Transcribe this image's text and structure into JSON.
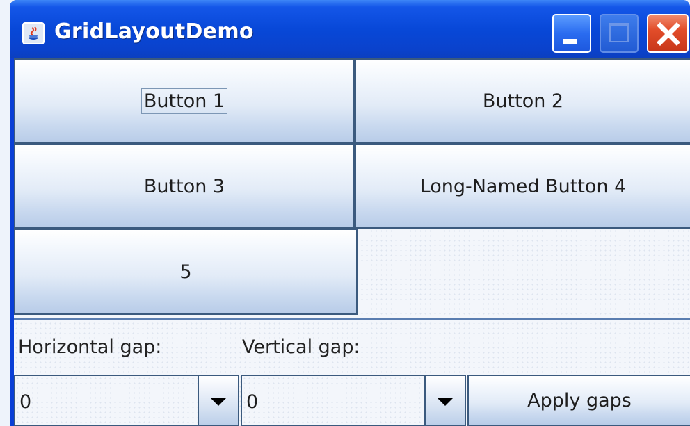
{
  "window": {
    "title": "GridLayoutDemo"
  },
  "titlebar": {
    "icons": [
      "java-icon",
      "minimize-icon",
      "maximize-icon",
      "close-icon"
    ]
  },
  "grid": {
    "buttons": [
      {
        "label": "Button 1",
        "focused": true
      },
      {
        "label": "Button 2",
        "focused": false
      },
      {
        "label": "Button 3",
        "focused": false
      },
      {
        "label": "Long-Named Button 4",
        "focused": false
      },
      {
        "label": "5",
        "focused": false
      }
    ]
  },
  "controls": {
    "horizontal_gap_label": "Horizontal gap:",
    "vertical_gap_label": "Vertical gap:",
    "horizontal_gap_value": "0",
    "vertical_gap_value": "0",
    "apply_label": "Apply gaps"
  },
  "colors": {
    "titlebar": "#0a48d8",
    "border": "#3b5a7e",
    "close": "#e24d2a"
  }
}
